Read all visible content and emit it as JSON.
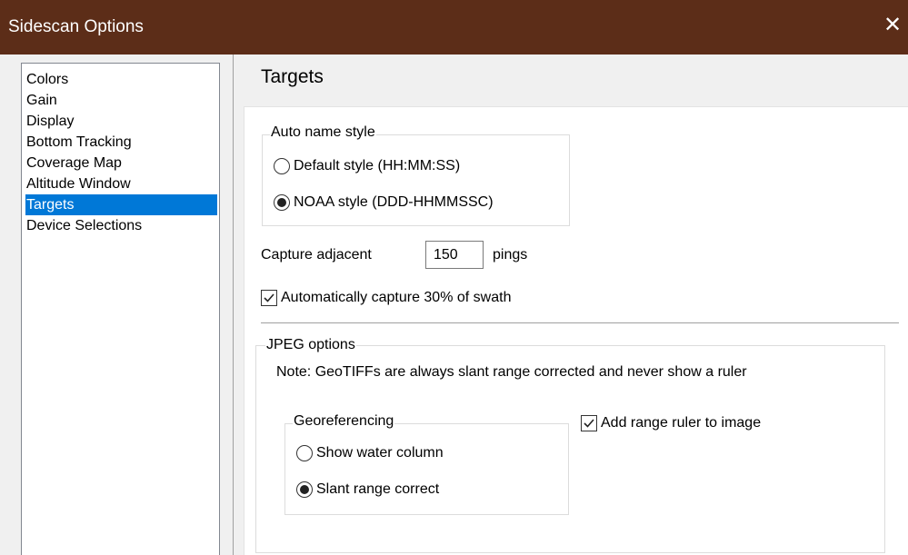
{
  "window": {
    "title": "Sidescan Options",
    "close_glyph": "✕"
  },
  "nav": {
    "items": [
      {
        "label": "Colors",
        "selected": false
      },
      {
        "label": "Gain",
        "selected": false
      },
      {
        "label": "Display",
        "selected": false
      },
      {
        "label": "Bottom Tracking",
        "selected": false
      },
      {
        "label": "Coverage Map",
        "selected": false
      },
      {
        "label": "Altitude Window",
        "selected": false
      },
      {
        "label": "Targets",
        "selected": true
      },
      {
        "label": "Device Selections",
        "selected": false
      }
    ]
  },
  "page": {
    "title": "Targets",
    "auto_name": {
      "group_label": "Auto name style",
      "default_label": "Default style (HH:MM:SS)",
      "default_checked": false,
      "noaa_label": "NOAA style (DDD-HHMMSSC)",
      "noaa_checked": true
    },
    "capture": {
      "label": "Capture adjacent",
      "value": "150",
      "unit": "pings"
    },
    "auto_capture": {
      "label": "Automatically capture 30% of swath",
      "checked": true
    },
    "jpeg": {
      "group_label": "JPEG options",
      "note": "Note: GeoTIFFs are always slant range corrected and never show a ruler",
      "georef": {
        "group_label": "Georeferencing",
        "water_column_label": "Show water column",
        "water_column_checked": false,
        "slant_range_label": "Slant range correct",
        "slant_range_checked": true
      },
      "range_ruler": {
        "label": "Add range ruler to image",
        "checked": true
      }
    }
  },
  "colors": {
    "titlebar": "#5c2d18",
    "selection": "#0078d7"
  }
}
